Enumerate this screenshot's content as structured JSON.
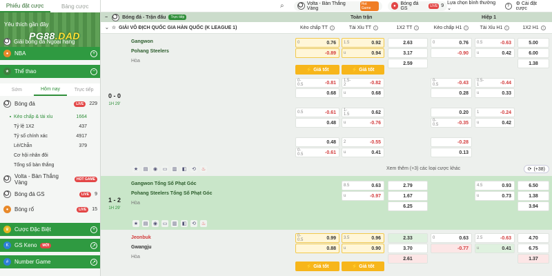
{
  "sidebar": {
    "tabs": [
      "Phiếu đặt cược",
      "Bảng cược"
    ],
    "banner": {
      "recent": "Yêu thích gần đây",
      "logo_main": "PG88",
      "logo_accent": ".DAD",
      "world": "Giải bóng đá Ngoại hạng"
    },
    "nba": "NBA",
    "sports_title": "Thể thao",
    "filters": [
      "Sớm",
      "Hôm nay",
      "Trực tiếp"
    ],
    "football": {
      "label": "Bóng đá",
      "badge": "LIVE",
      "count": "229"
    },
    "subs": [
      {
        "label": "Kèo chấp & tài xỉu",
        "count": "1664",
        "sel": true
      },
      {
        "label": "Tỷ lệ 1X2",
        "count": "437"
      },
      {
        "label": "Tỷ số chính xác",
        "count": "4917"
      },
      {
        "label": "Lẻ/Chẵn",
        "count": "379"
      },
      {
        "label": "Cơ hội nhân đôi",
        "count": ""
      },
      {
        "label": "Tổng số bàn thắng",
        "count": ""
      }
    ],
    "volta": {
      "label": "Volta - Bàn Thắng Vàng",
      "badge": "HOT GAME"
    },
    "gs": {
      "label": "Bóng đá GS",
      "badge": "LIVE",
      "count": "9"
    },
    "ro": {
      "label": "Bóng rổ",
      "badge": "LIVE",
      "count": "15"
    },
    "special": "Cược Đặc Biệt",
    "keno": {
      "label": "GS Keno",
      "badge": "MỚI"
    },
    "number": "Number Game"
  },
  "topbar": {
    "volta": "Volta - Bàn Thắng Vàng",
    "volta_badge": "Hot Game",
    "gs": "Bóng đá GS",
    "gs_badge": "LIVE",
    "gs_count": "9",
    "view": "Lựa chọn bình thường",
    "settings": "Cài đặt cược"
  },
  "header": {
    "sport": "Bóng đá - Trận đấu",
    "trial": "Trực tiếp",
    "full": "Toàn trận",
    "half": "Hiệp 1",
    "league": "GIẢI VÔ ĐỊCH QUỐC GIA HÀN QUỐC (K LEAGUE 1)",
    "cols": [
      "Kèo chấp TT",
      "Tài Xỉu TT",
      "1X2 TT",
      "Kèo chấp H1",
      "Tài Xỉu H1",
      "1X2 H1"
    ]
  },
  "best_label": "Giá tốt",
  "matches": [
    {
      "score": "0 - 0",
      "time": "1H 29'",
      "home": "Gangwon",
      "away": "Pohang Steelers",
      "draw": "Hòa",
      "more": "Xem thêm (+3) các loại cược khác",
      "more_pill": "(+38)"
    },
    {
      "score": "1 - 2",
      "time": "1H 29'",
      "home": "Gangwon Tổng Số Phạt Góc",
      "away": "Pohang Steelers Tổng Số Phạt Góc",
      "draw": "Hòa"
    },
    {
      "score": "",
      "time": "",
      "home": "Jeonbuk",
      "away": "Gwangju",
      "draw": "Hòa"
    }
  ],
  "odds": {
    "m1": [
      [
        "0",
        "0.76",
        "1.5",
        "0.92",
        "2.63",
        "0",
        "0.76",
        "0.5",
        "-0.63",
        "5.00"
      ],
      [
        "",
        "-0.89",
        "u",
        "0.94",
        "3.17",
        "",
        "-0.90",
        "u",
        "0.42",
        "6.00"
      ],
      [
        "",
        "",
        "",
        "",
        "2.59",
        "",
        "",
        "",
        "",
        "1.38"
      ],
      [
        "0-0.5",
        "-0.81",
        "1.5-2",
        "-0.82",
        "",
        "0-0.5",
        "-0.43",
        "0.5-1",
        "-0.44",
        ""
      ],
      [
        "",
        "0.68",
        "u",
        "0.68",
        "",
        "",
        "0.28",
        "u",
        "0.33",
        ""
      ],
      [
        "0.5",
        "-0.61",
        "1-1.5",
        "0.62",
        "",
        "",
        "0.20",
        "1",
        "-0.24",
        ""
      ],
      [
        "",
        "0.48",
        "u",
        "-0.76",
        "",
        "0-0.5",
        "-0.35",
        "u",
        "0.42",
        ""
      ],
      [
        "",
        "0.48",
        "2",
        "-0.55",
        "",
        "",
        "-0.28",
        "",
        "",
        ""
      ],
      [
        "0-0.5",
        "-0.61",
        "u",
        "0.41",
        "",
        "",
        "0.13",
        "",
        "",
        ""
      ]
    ],
    "m2": [
      [
        "",
        "",
        "8.5",
        "0.63",
        "2.79",
        "",
        "",
        "4.5",
        "0.93",
        "6.50"
      ],
      [
        "",
        "",
        "u",
        "-0.97",
        "1.67",
        "",
        "",
        "u",
        "0.73",
        "1.38"
      ],
      [
        "",
        "",
        "",
        "",
        "6.25",
        "",
        "",
        "",
        "",
        "3.94"
      ]
    ],
    "m3": [
      [
        "0-0.5",
        "0.99",
        "3.5",
        "0.96",
        "2.33",
        "0",
        "0.63",
        "2.5",
        "-0.63",
        "4.70"
      ],
      [
        "",
        "0.88",
        "u",
        "0.90",
        "3.70",
        "",
        "-0.77",
        "u",
        "0.41",
        "6.75"
      ],
      [
        "",
        "",
        "",
        "",
        "2.61",
        "",
        "",
        "",
        "",
        "1.37"
      ]
    ]
  }
}
